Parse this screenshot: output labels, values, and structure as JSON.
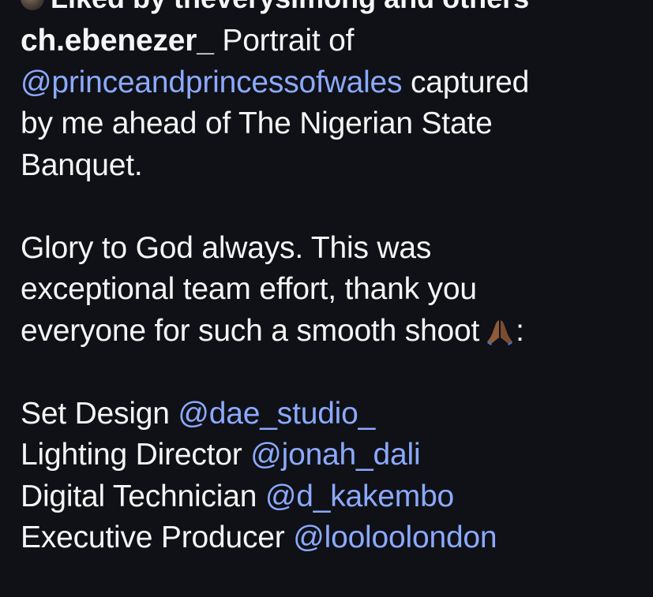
{
  "liked_row": {
    "text": "Liked by theveryslmong and others"
  },
  "caption": {
    "username": "ch.ebenezer_",
    "intro_text": "Portrait of",
    "mention_royal": "@princeandprincessofwales",
    "after_royal": "captured",
    "line3": "by me ahead of The Nigerian State",
    "line4": "Banquet.",
    "line6": "Glory to God always. This was",
    "line7": "exceptional team effort, thank you",
    "line8": "everyone for such a smooth shoot",
    "line8_suffix": ":",
    "emoji_icon": "praying-hands-icon",
    "credits": [
      {
        "role": "Set Design",
        "handle": "@dae_studio_"
      },
      {
        "role": "Lighting Director",
        "handle": "@jonah_dali"
      },
      {
        "role": "Digital Technician",
        "handle": "@d_kakembo"
      },
      {
        "role": "Executive Producer",
        "handle": "@looloolondon"
      }
    ]
  },
  "colors": {
    "background": "#0f1116",
    "text": "#f5f5f5",
    "mention": "#8ca9ff",
    "emoji_skin": "#8d5a3b"
  }
}
